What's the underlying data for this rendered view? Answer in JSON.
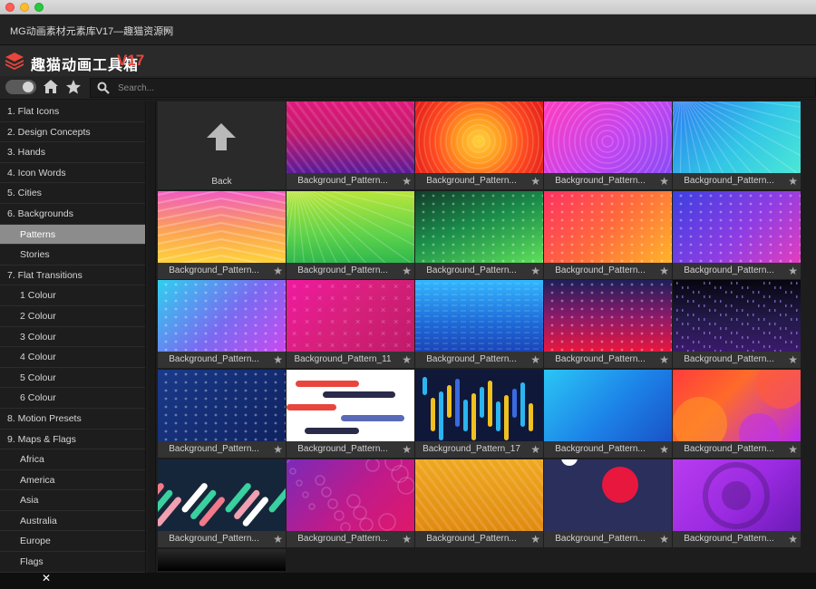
{
  "window": {
    "title": "MG动画素材元素库V17—趣猫资源网",
    "menu_icon": "hamburger-icon"
  },
  "app": {
    "name": "趣猫动画工具箱",
    "version": "V17"
  },
  "toolbar": {
    "search_placeholder": "Search..."
  },
  "sidebar": {
    "items": [
      {
        "label": "1. Flat Icons",
        "sub": false
      },
      {
        "label": "2. Design Concepts",
        "sub": false
      },
      {
        "label": "3. Hands",
        "sub": false
      },
      {
        "label": "4. Icon Words",
        "sub": false
      },
      {
        "label": "5. Cities",
        "sub": false
      },
      {
        "label": "6. Backgrounds",
        "sub": false
      },
      {
        "label": "Patterns",
        "sub": true,
        "active": true
      },
      {
        "label": "Stories",
        "sub": true
      },
      {
        "label": "7. Flat Transitions",
        "sub": false
      },
      {
        "label": "1 Colour",
        "sub": true
      },
      {
        "label": "2 Colour",
        "sub": true
      },
      {
        "label": "3 Colour",
        "sub": true
      },
      {
        "label": "4 Colour",
        "sub": true
      },
      {
        "label": "5 Colour",
        "sub": true
      },
      {
        "label": "6 Colour",
        "sub": true
      },
      {
        "label": "8. Motion Presets",
        "sub": false
      },
      {
        "label": "9. Maps & Flags",
        "sub": false
      },
      {
        "label": "Africa",
        "sub": true
      },
      {
        "label": "America",
        "sub": true
      },
      {
        "label": "Asia",
        "sub": true
      },
      {
        "label": "Australia",
        "sub": true
      },
      {
        "label": "Europe",
        "sub": true
      },
      {
        "label": "Flags",
        "sub": true
      }
    ]
  },
  "grid": {
    "back_label": "Back",
    "tiles": [
      {
        "label": "Background_Pattern...",
        "bg": "linear-gradient(180deg,#e0197a 0%,#c21a6e 45%,#5a1a9a 100%)",
        "pattern": "lines"
      },
      {
        "label": "Background_Pattern...",
        "bg": "radial-gradient(circle at 50% 55%,#ffd23a 0%,#ff9a1f 30%,#ff4b1f 60%,#e01818 100%)",
        "pattern": "rings"
      },
      {
        "label": "Background_Pattern...",
        "bg": "linear-gradient(135deg,#ff3cc0 0%,#c545f0 55%,#8a4af5 100%)",
        "pattern": "rings"
      },
      {
        "label": "Background_Pattern...",
        "bg": "linear-gradient(135deg,#2a7bf0 0%,#32c6e6 55%,#4be8d6 100%)",
        "pattern": "rays"
      },
      {
        "label": "Background_Pattern...",
        "bg": "linear-gradient(180deg,#f15cc0 0%,#fba255 55%,#ffd23a 100%)",
        "pattern": "chevron"
      },
      {
        "label": "Background_Pattern...",
        "bg": "linear-gradient(180deg,#b9e63c 0%,#5fd34a 60%,#2fb84d 100%)",
        "pattern": "rays"
      },
      {
        "label": "Background_Pattern...",
        "bg": "linear-gradient(160deg,#123c2a 0%,#1a8c4a 45%,#5ee05a 100%)",
        "pattern": "dots"
      },
      {
        "label": "Background_Pattern...",
        "bg": "linear-gradient(135deg,#ff2f62 0%,#ff6a3c 50%,#ffb52a 100%)",
        "pattern": "dots"
      },
      {
        "label": "Background_Pattern...",
        "bg": "linear-gradient(135deg,#3b3fe0 0%,#8d3de3 55%,#e43dbf 100%)",
        "pattern": "dots"
      },
      {
        "label": "Background_Pattern...",
        "bg": "linear-gradient(135deg,#2fd0f0 0%,#7a6af0 55%,#c84af0 100%)",
        "pattern": "dots"
      },
      {
        "label": "Background_Pattern_11",
        "bg": "linear-gradient(135deg,#f01aa0 0%,#d6207a 50%,#c01a6a 100%)",
        "pattern": "crosses"
      },
      {
        "label": "Background_Pattern...",
        "bg": "linear-gradient(180deg,#33b8ff 0%,#1e6ad8 60%,#1a45b8 100%)",
        "pattern": "hlines"
      },
      {
        "label": "Background_Pattern...",
        "bg": "linear-gradient(180deg,#1f1f5a 0%,#8a1a6a 50%,#e8173e 100%)",
        "pattern": "dots"
      },
      {
        "label": "Background_Pattern...",
        "bg": "linear-gradient(180deg,#06060f 0%,#231a4a 55%,#3a1a6a 100%)",
        "pattern": "matrix"
      },
      {
        "label": "Background_Pattern...",
        "bg": "linear-gradient(135deg,#1a3a8a 0%,#0f2260 100%)",
        "pattern": "dots"
      },
      {
        "label": "Background_Pattern...",
        "bg": "#ffffff",
        "pattern": "pills"
      },
      {
        "label": "Background_Pattern_17",
        "bg": "#0f1838",
        "pattern": "bars"
      },
      {
        "label": "Background_Pattern...",
        "bg": "linear-gradient(135deg,#2bc6f5 0%,#1c82e8 55%,#1a52c8 100%)",
        "pattern": "none"
      },
      {
        "label": "Background_Pattern...",
        "bg": "linear-gradient(135deg,#ff3c3c 0%,#ff6a2a 40%,#b72af0 100%)",
        "pattern": "blobs"
      },
      {
        "label": "Background_Pattern...",
        "bg": "#16263a",
        "pattern": "diagpills"
      },
      {
        "label": "Background_Pattern...",
        "bg": "linear-gradient(135deg,#7a2ab8 0%,#c01a8a 55%,#e0186a 100%)",
        "pattern": "circles"
      },
      {
        "label": "Background_Pattern...",
        "bg": "linear-gradient(180deg,#f0a820 0%,#e08a10 100%)",
        "pattern": "lines"
      },
      {
        "label": "Background_Pattern...",
        "bg": "#2a2f5c",
        "pattern": "bigdot"
      },
      {
        "label": "Background_Pattern...",
        "bg": "linear-gradient(135deg,#b83cf0 0%,#9a2ae0 55%,#6a1ab8 100%)",
        "pattern": "target"
      }
    ]
  },
  "bottom": {
    "close_icon": "close-icon"
  },
  "colors": {
    "accent": "#e8463c",
    "sidebar_active": "#8c8c8c"
  }
}
